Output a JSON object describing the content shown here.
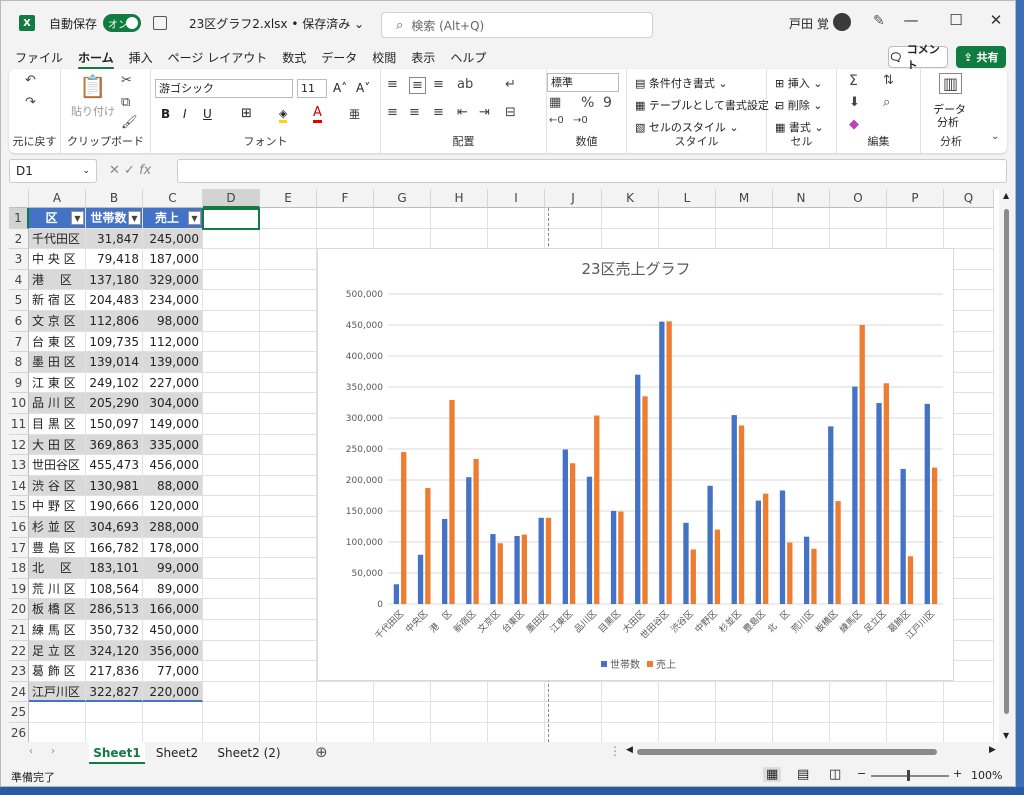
{
  "title": {
    "autosave_label": "自動保存",
    "autosave_state": "オン",
    "filename": "23区グラフ2.xlsx • 保存済み ⌄",
    "search_placeholder": "検索 (Alt+Q)",
    "user_name": "戸田 覚"
  },
  "menu": [
    "ファイル",
    "ホーム",
    "挿入",
    "ページ レイアウト",
    "数式",
    "データ",
    "校閲",
    "表示",
    "ヘルプ"
  ],
  "menu_active": "ホーム",
  "buttons": {
    "comment": "コメント",
    "share": "共有"
  },
  "ribbon": {
    "undo_group": "元に戻す",
    "clipboard_group": "クリップボード",
    "paste": "貼り付け",
    "font_group": "フォント",
    "font_name": "游ゴシック",
    "font_size": "11",
    "align_group": "配置",
    "number_group": "数値",
    "number_format": "標準",
    "style_group": "スタイル",
    "conditional": "条件付き書式 ⌄",
    "as_table": "テーブルとして書式設定 ⌄",
    "cell_style": "セルのスタイル ⌄",
    "cells_group": "セル",
    "insert": "挿入",
    "delete": "削除",
    "format": "書式 ⌄",
    "edit_group": "編集",
    "analysis_group": "分析",
    "data_analysis_1": "データ",
    "data_analysis_2": "分析"
  },
  "name_box": "D1",
  "columns": [
    "A",
    "B",
    "C",
    "D",
    "E",
    "F",
    "G",
    "H",
    "I",
    "J",
    "K",
    "L",
    "M",
    "N",
    "O",
    "P",
    "Q"
  ],
  "table": {
    "headers": [
      "区",
      "世帯数",
      "売上"
    ],
    "rows": [
      [
        "千代田区",
        "31,847",
        "245,000"
      ],
      [
        "中 央 区",
        "79,418",
        "187,000"
      ],
      [
        "港　 区",
        "137,180",
        "329,000"
      ],
      [
        "新 宿 区",
        "204,483",
        "234,000"
      ],
      [
        "文 京 区",
        "112,806",
        "98,000"
      ],
      [
        "台 東 区",
        "109,735",
        "112,000"
      ],
      [
        "墨 田 区",
        "139,014",
        "139,000"
      ],
      [
        "江 東 区",
        "249,102",
        "227,000"
      ],
      [
        "品 川 区",
        "205,290",
        "304,000"
      ],
      [
        "目 黒 区",
        "150,097",
        "149,000"
      ],
      [
        "大 田 区",
        "369,863",
        "335,000"
      ],
      [
        "世田谷区",
        "455,473",
        "456,000"
      ],
      [
        "渋 谷 区",
        "130,981",
        "88,000"
      ],
      [
        "中 野 区",
        "190,666",
        "120,000"
      ],
      [
        "杉 並 区",
        "304,693",
        "288,000"
      ],
      [
        "豊 島 区",
        "166,782",
        "178,000"
      ],
      [
        "北　 区",
        "183,101",
        "99,000"
      ],
      [
        "荒 川 区",
        "108,564",
        "89,000"
      ],
      [
        "板 橋 区",
        "286,513",
        "166,000"
      ],
      [
        "練 馬 区",
        "350,732",
        "450,000"
      ],
      [
        "足 立 区",
        "324,120",
        "356,000"
      ],
      [
        "葛 飾 区",
        "217,836",
        "77,000"
      ],
      [
        "江戸川区",
        "322,827",
        "220,000"
      ]
    ]
  },
  "chart_data": {
    "type": "bar",
    "title": "23区売上グラフ",
    "categories": [
      "千代田区",
      "中央区",
      "港　区",
      "新宿区",
      "文京区",
      "台東区",
      "墨田区",
      "江東区",
      "品川区",
      "目黒区",
      "大田区",
      "世田谷区",
      "渋谷区",
      "中野区",
      "杉並区",
      "豊島区",
      "北　区",
      "荒川区",
      "板橋区",
      "練馬区",
      "足立区",
      "葛飾区",
      "江戸川区"
    ],
    "series": [
      {
        "name": "世帯数",
        "color": "#4472c4",
        "values": [
          31847,
          79418,
          137180,
          204483,
          112806,
          109735,
          139014,
          249102,
          205290,
          150097,
          369863,
          455473,
          130981,
          190666,
          304693,
          166782,
          183101,
          108564,
          286513,
          350732,
          324120,
          217836,
          322827
        ]
      },
      {
        "name": "売上",
        "color": "#ed7d31",
        "values": [
          245000,
          187000,
          329000,
          234000,
          98000,
          112000,
          139000,
          227000,
          304000,
          149000,
          335000,
          456000,
          88000,
          120000,
          288000,
          178000,
          99000,
          89000,
          166000,
          450000,
          356000,
          77000,
          220000
        ]
      }
    ],
    "ylim": [
      0,
      500000
    ],
    "yticks": [
      "0",
      "50,000",
      "100,000",
      "150,000",
      "200,000",
      "250,000",
      "300,000",
      "350,000",
      "400,000",
      "450,000",
      "500,000"
    ],
    "legend": "bottom",
    "grid": true
  },
  "sheets": [
    "Sheet1",
    "Sheet2",
    "Sheet2 (2)"
  ],
  "active_sheet": "Sheet1",
  "status": {
    "ready": "準備完了",
    "zoom": "100%"
  }
}
